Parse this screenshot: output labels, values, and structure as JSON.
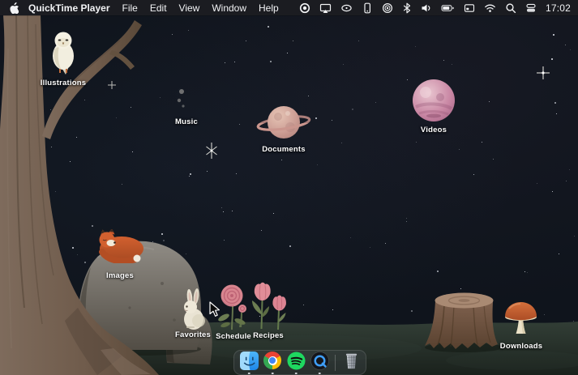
{
  "menu_bar": {
    "apple_logo_icon": "apple-logo",
    "app_name": "QuickTime Player",
    "menus": [
      "File",
      "Edit",
      "View",
      "Window",
      "Help"
    ],
    "status_icons": [
      "record",
      "screen-mirroring",
      "mouse",
      "iphone",
      "webcam",
      "bluetooth",
      "volume",
      "battery",
      "input-source",
      "wifi",
      "search",
      "control-center"
    ],
    "clock": "17:02"
  },
  "desktop": {
    "wallpaper": "watercolor night forest with tree, rocks, stump and starry sky",
    "items": [
      {
        "label": "Illustrations",
        "icon": "owl"
      },
      {
        "label": "Music",
        "icon": "crescent-moon"
      },
      {
        "label": "Documents",
        "icon": "ringed-planet"
      },
      {
        "label": "Videos",
        "icon": "pink-planet"
      },
      {
        "label": "Images",
        "icon": "sleeping-fox-on-rock"
      },
      {
        "label": "Favorites",
        "icon": "rabbit"
      },
      {
        "label": "Schedule",
        "icon": "rose"
      },
      {
        "label": "Recipes",
        "icon": "tulips"
      },
      {
        "label": "Downloads",
        "icon": "mushroom"
      }
    ]
  },
  "dock": {
    "apps": [
      {
        "name": "Finder",
        "running": true
      },
      {
        "name": "Google Chrome",
        "running": true
      },
      {
        "name": "Spotify",
        "running": true
      },
      {
        "name": "QuickTime Player",
        "running": true
      }
    ],
    "trash_name": "Trash"
  },
  "colors": {
    "sky": "#0f141c",
    "menu_bar": "#1c1d21",
    "label_text": "#ffffff",
    "tree": "#6f5b4b",
    "ground": "#2b362f",
    "rock": "#8f8b84",
    "fox_orange": "#cf5c2d",
    "mushroom_cap": "#c75f31",
    "spotify_green": "#1ed760",
    "chrome_red": "#ea4335",
    "chrome_yellow": "#fbbc05",
    "chrome_green": "#34a853",
    "chrome_blue": "#4285f4",
    "finder_blue": "#2f9ef4",
    "quicktime_blue": "#3f9ef8"
  }
}
